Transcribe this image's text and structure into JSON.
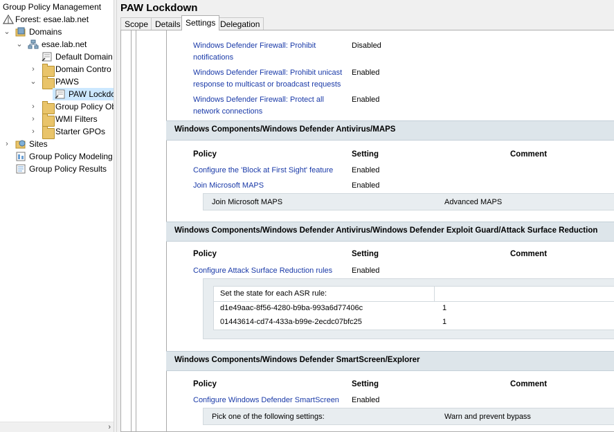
{
  "tree": {
    "root": "Group Policy Management",
    "forest": "Forest: esae.lab.net",
    "domains": "Domains",
    "domain": "esae.lab.net",
    "default_domain": "Default Domain",
    "domain_controllers": "Domain Contro",
    "paws": "PAWS",
    "paw_lockdown": "PAW Lockdc",
    "group_policy_objects": "Group Policy Ob",
    "wmi_filters": "WMI Filters",
    "starter_gpos": "Starter GPOs",
    "sites": "Sites",
    "gp_modeling": "Group Policy Modeling",
    "gp_results": "Group Policy Results"
  },
  "gpo": {
    "title": "PAW Lockdown",
    "tabs": [
      "Scope",
      "Details",
      "Settings",
      "Delegation"
    ],
    "active_tab": "Settings"
  },
  "report": {
    "firewall_rows": [
      {
        "policy_line1": "Windows Defender Firewall: Prohibit",
        "policy_line2": "notifications",
        "setting": "Disabled"
      },
      {
        "policy_line1": "Windows Defender Firewall: Prohibit unicast",
        "policy_line2": "response to multicast or broadcast requests",
        "setting": "Enabled"
      },
      {
        "policy_line1": "Windows Defender Firewall: Protect all",
        "policy_line2": "network connections",
        "setting": "Enabled"
      }
    ],
    "col_policy": "Policy",
    "col_setting": "Setting",
    "col_comment": "Comment",
    "maps": {
      "title": "Windows Components/Windows Defender Antivirus/MAPS",
      "rows": [
        {
          "policy": "Configure the 'Block at First Sight' feature",
          "setting": "Enabled"
        },
        {
          "policy": "Join Microsoft MAPS",
          "setting": "Enabled"
        }
      ],
      "detail_label": "Join Microsoft MAPS",
      "detail_value": "Advanced MAPS"
    },
    "asr": {
      "title": "Windows Components/Windows Defender Antivirus/Windows Defender Exploit Guard/Attack Surface Reduction",
      "rows": [
        {
          "policy": "Configure Attack Surface Reduction rules",
          "setting": "Enabled"
        }
      ],
      "detail_header": "Set the state for each ASR rule:",
      "rules": [
        {
          "id": "d1e49aac-8f56-4280-b9ba-993a6d77406c",
          "state": "1"
        },
        {
          "id": "01443614-cd74-433a-b99e-2ecdc07bfc25",
          "state": "1"
        }
      ]
    },
    "smartscreen": {
      "title": "Windows Components/Windows Defender SmartScreen/Explorer",
      "rows": [
        {
          "policy": "Configure Windows Defender SmartScreen",
          "setting": "Enabled"
        }
      ],
      "detail_label": "Pick one of the following settings:",
      "detail_value": "Warn and prevent bypass"
    }
  }
}
